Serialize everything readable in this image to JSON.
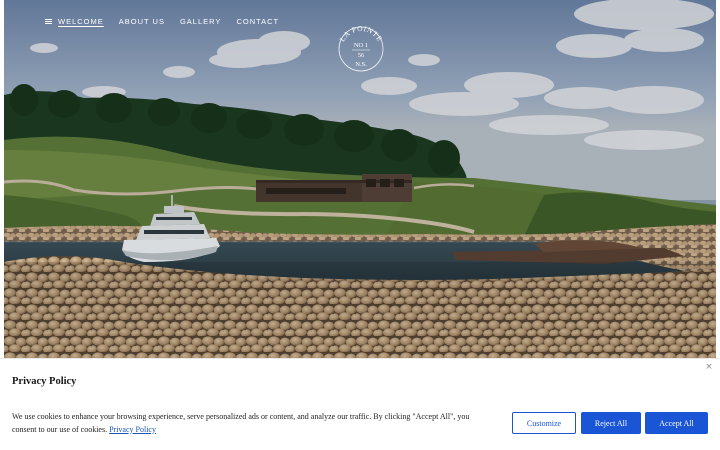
{
  "nav": {
    "items": [
      {
        "label": "WELCOME",
        "active": true,
        "icon": "menu-icon"
      },
      {
        "label": "ABOUT US",
        "active": false
      },
      {
        "label": "GALLERY",
        "active": false
      },
      {
        "label": "CONTACT",
        "active": false
      }
    ]
  },
  "logo": {
    "arc_text": "LA POINTE",
    "line1": "NO 1",
    "line2": "56",
    "line3": "N.S."
  },
  "cookie_banner": {
    "title": "Privacy Policy",
    "text": "We use cookies to enhance your browsing experience, serve personalized ads or content, and analyze our traffic. By clicking \"Accept All\", you consent to our use of cookies.",
    "link_text": "Privacy Policy",
    "close_icon": "close-icon",
    "buttons": {
      "customize": "Customize",
      "reject": "Reject All",
      "accept": "Accept All"
    }
  },
  "colors": {
    "accent": "#1a55d6",
    "link": "#1a55b5"
  }
}
